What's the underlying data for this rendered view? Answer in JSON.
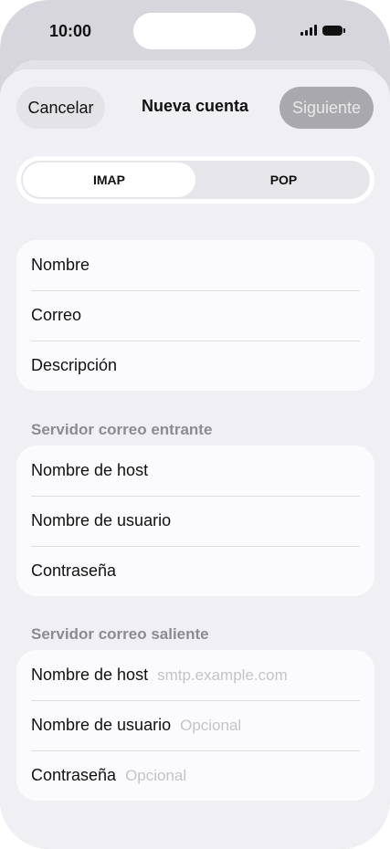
{
  "status_bar": {
    "time": "10:00"
  },
  "nav": {
    "cancel_label": "Cancelar",
    "title": "Nueva cuenta",
    "next_label": "Siguiente"
  },
  "segmented": {
    "options": [
      "IMAP",
      "POP"
    ],
    "selected": "IMAP"
  },
  "account": {
    "fields": [
      {
        "label": "Nombre"
      },
      {
        "label": "Correo"
      },
      {
        "label": "Descripción"
      }
    ]
  },
  "incoming": {
    "header": "Servidor correo entrante",
    "fields": [
      {
        "label": "Nombre de host"
      },
      {
        "label": "Nombre de usuario"
      },
      {
        "label": "Contraseña"
      }
    ]
  },
  "outgoing": {
    "header": "Servidor correo saliente",
    "fields": [
      {
        "label": "Nombre de host",
        "placeholder": "smtp.example.com"
      },
      {
        "label": "Nombre de usuario",
        "placeholder": "Opcional"
      },
      {
        "label": "Contraseña",
        "placeholder": "Opcional"
      }
    ]
  },
  "colors": {
    "background": "#f0eff4",
    "card": "#fbfbfd",
    "disabled_button": "#a9a8ad"
  }
}
